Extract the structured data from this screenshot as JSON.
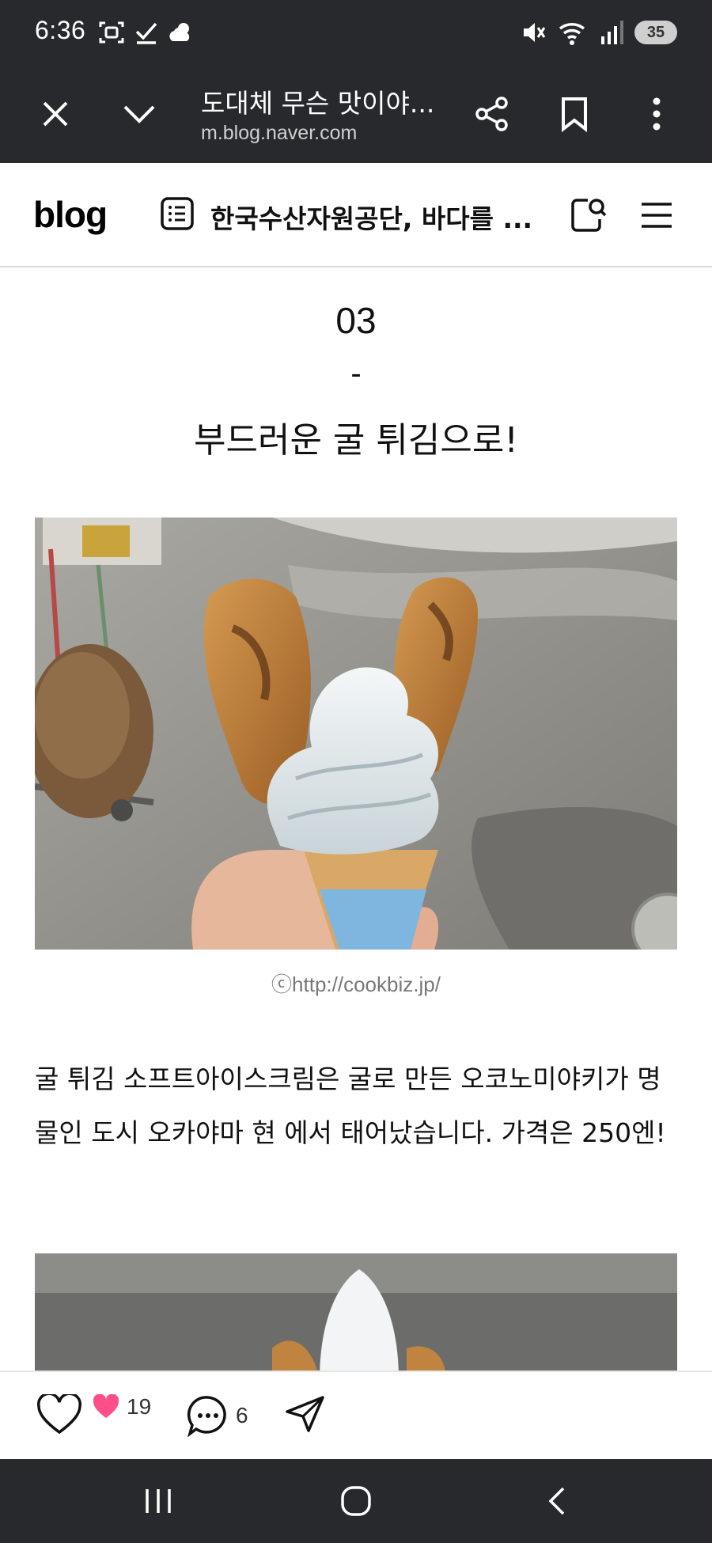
{
  "status_bar": {
    "time": "6:36",
    "battery": "35",
    "left_icons": [
      "screenshot-icon",
      "check-icon",
      "weather-icon"
    ],
    "right_icons": [
      "mute-icon",
      "wifi-icon",
      "signal-icon",
      "battery-icon"
    ]
  },
  "browser": {
    "page_title": "도대체 무슨 맛이야...",
    "url": "m.blog.naver.com",
    "buttons": [
      "close-icon",
      "chevron-down-icon",
      "share-icon",
      "bookmark-icon",
      "more-icon"
    ]
  },
  "blog_header": {
    "logo": "blog",
    "blog_name": "한국수산자원공단, 바다를 ...",
    "icons": [
      "post-list-icon",
      "search-icon",
      "menu-icon"
    ]
  },
  "article": {
    "section_number": "03",
    "section_dash": "-",
    "section_title": "부드러운 굴 튀김으로!",
    "image_caption": "ⓒhttp://cookbiz.jp/",
    "paragraph": "굴 튀김 소프트아이스크림은 굴로 만든 오코노미야키가 명물인 도시 오카야마 현 에서 태어났습니다.  가격은 250엔!"
  },
  "actions": {
    "like_count": "19",
    "comment_count": "6"
  },
  "colors": {
    "system_bar": "#28292c",
    "heart_pink": "#ff4f8b",
    "caption_gray": "#777777"
  }
}
